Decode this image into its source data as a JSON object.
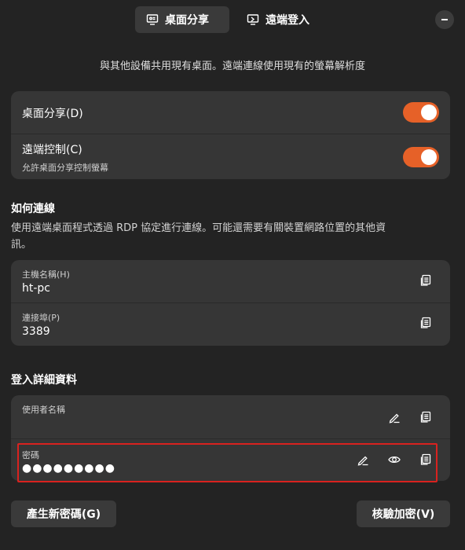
{
  "header": {
    "tabs": [
      {
        "label": "桌面分享",
        "icon": "desktop-share-icon",
        "active": true
      },
      {
        "label": "遠端登入",
        "icon": "remote-login-icon",
        "active": false
      }
    ],
    "window_control": "minimize-icon"
  },
  "subtitle": "與其他設備共用現有桌面。遠端連線使用現有的螢幕解析度",
  "toggles": [
    {
      "label": "桌面分享(D)",
      "subtitle": "",
      "on": true
    },
    {
      "label": "遠端控制(C)",
      "subtitle": "允許桌面分享控制螢幕",
      "on": true
    }
  ],
  "connect": {
    "heading": "如何連線",
    "description_line1": "使用遠端桌面程式透過 RDP 協定進行連線。可能還需要有關裝置網路位置的其他資",
    "description_line2": "訊。",
    "hostname_label": "主機名稱(H)",
    "hostname_value": "ht-pc",
    "port_label": "連接埠(P)",
    "port_value": "3389"
  },
  "login": {
    "heading": "登入詳細資料",
    "username_label": "使用者名稱",
    "username_value": "",
    "password_label": "密碼",
    "password_value": "●●●●●●●●●"
  },
  "buttons": {
    "generate_password": "產生新密碼(G)",
    "verify_encryption": "核驗加密(V)"
  },
  "colors": {
    "accent": "#e66128",
    "background": "#232323",
    "card": "#363636",
    "highlight": "#d9221f"
  }
}
